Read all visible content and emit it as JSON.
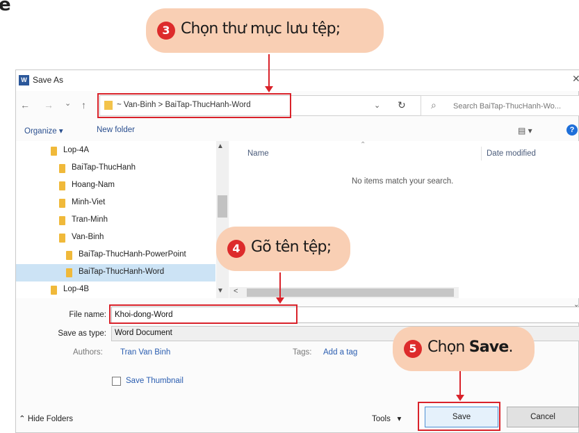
{
  "corner_char": "e",
  "window": {
    "title": "Save As",
    "app_icon_letter": "W"
  },
  "nav": {
    "back_icon": "←",
    "forward_icon": "→",
    "recent_icon": "⌄",
    "up_icon": "↑",
    "path": "~  Van-Binh  >  BaiTap-ThucHanh-Word",
    "dropdown_icon": "⌄",
    "refresh_icon": "↻",
    "search_icon": "⌕",
    "search_placeholder": "Search BaiTap-ThucHanh-Wo..."
  },
  "toolbar": {
    "organize": "Organize ▾",
    "new_folder": "New folder",
    "view": "▤ ▾",
    "help": "?"
  },
  "tree": [
    {
      "label": "Lop-4A",
      "selected": false
    },
    {
      "label": "BaiTap-ThucHanh",
      "selected": false
    },
    {
      "label": "Hoang-Nam",
      "selected": false
    },
    {
      "label": "Minh-Viet",
      "selected": false
    },
    {
      "label": "Tran-Minh",
      "selected": false
    },
    {
      "label": "Van-Binh",
      "selected": false
    },
    {
      "label": "BaiTap-ThucHanh-PowerPoint",
      "selected": false
    },
    {
      "label": "BaiTap-ThucHanh-Word",
      "selected": true
    },
    {
      "label": "Lop-4B",
      "selected": false
    }
  ],
  "content": {
    "col_name": "Name",
    "col_date": "Date modified",
    "empty_message": "No items match your search."
  },
  "form": {
    "file_name_label": "File name:",
    "file_name_value": "Khoi-dong-Word",
    "save_type_label": "Save as type:",
    "save_type_value": "Word Document",
    "authors_label": "Authors:",
    "authors_value": "Tran Van Binh",
    "tags_label": "Tags:",
    "tags_value": "Add a tag",
    "thumbnail_label": "Save Thumbnail"
  },
  "footer": {
    "hide_folders": "Hide Folders",
    "tools": "Tools",
    "save": "Save",
    "cancel": "Cancel"
  },
  "annotations": {
    "step3": {
      "number": "3",
      "text": "Chọn thư mục lưu tệp;"
    },
    "step4": {
      "number": "4",
      "text": "Gõ tên tệp;"
    },
    "step5": {
      "number": "5",
      "text_pre": "Chọn ",
      "text_bold": "Save",
      "text_post": "."
    }
  },
  "colors": {
    "accent_red": "#d9222a",
    "callout_bg": "#f9cfb4",
    "folder": "#f0b93a",
    "link": "#2a5db0"
  }
}
